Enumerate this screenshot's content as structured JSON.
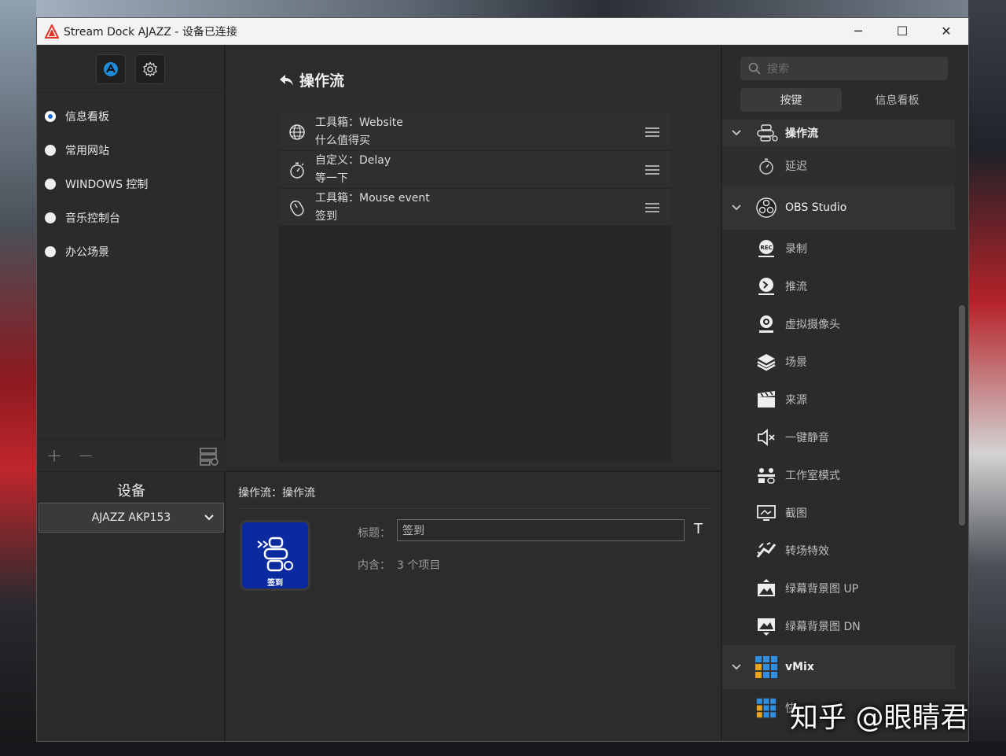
{
  "window": {
    "title": "Stream Dock AJAZZ - 设备已连接",
    "controls": {
      "minimize": "─",
      "maximize": "☐",
      "close": "✕"
    }
  },
  "left": {
    "top_buttons": [
      {
        "icon": "ajazz-logo-icon"
      },
      {
        "icon": "gear-icon"
      }
    ],
    "profiles": [
      {
        "label": "信息看板",
        "selected": true
      },
      {
        "label": "常用网站",
        "selected": false
      },
      {
        "label": "WINDOWS 控制",
        "selected": false
      },
      {
        "label": "音乐控制台",
        "selected": false
      },
      {
        "label": "办公场景",
        "selected": false
      }
    ],
    "tools": {
      "add": "+",
      "remove": "−"
    },
    "device_heading": "设备",
    "device_selected": "AJAZZ AKP153"
  },
  "center": {
    "back_title": "操作流",
    "flow_items": [
      {
        "line1": "工具箱：Website",
        "line2": "什么值得买",
        "icon": "globe-icon"
      },
      {
        "line1": "自定义：Delay",
        "line2": "等一下",
        "icon": "stopwatch-icon"
      },
      {
        "line1": "工具箱：Mouse event",
        "line2": "签到",
        "icon": "mouse-icon"
      }
    ],
    "props": {
      "heading": "操作流：操作流",
      "tile_label": "签到",
      "title_label": "标题：",
      "title_value": "签到",
      "t_button": "T",
      "contains_label": "内含：",
      "contains_value": "3 个项目"
    }
  },
  "right": {
    "search_placeholder": "搜索",
    "tabs": [
      {
        "label": "按键",
        "active": true
      },
      {
        "label": "信息看板",
        "active": false
      }
    ],
    "categories": {
      "flow": {
        "label": "操作流",
        "items": [
          "延迟"
        ]
      },
      "obs": {
        "label": "OBS Studio",
        "items": [
          "录制",
          "推流",
          "虚拟摄像头",
          "场景",
          "来源",
          "一键静音",
          "工作室模式",
          "截图",
          "转场特效",
          "绿幕背景图 UP",
          "绿幕背景图 DN"
        ]
      },
      "vmix": {
        "label": "vMix",
        "items": [
          "快"
        ]
      }
    }
  },
  "watermark": "知乎 @眼睛君",
  "colors": {
    "accent_blue": "#1e6ad8",
    "tile_blue": "#0b2aa0",
    "panel": "#2c2c2c"
  }
}
